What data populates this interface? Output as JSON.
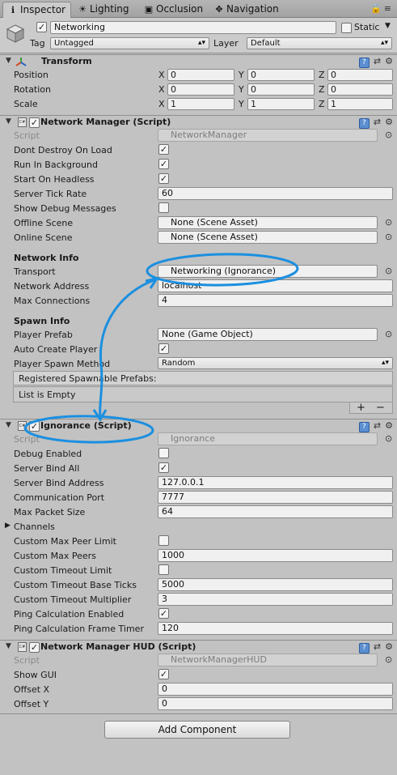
{
  "tabs": [
    {
      "label": "Inspector",
      "icon": "info-icon"
    },
    {
      "label": "Lighting",
      "icon": "bulb-icon"
    },
    {
      "label": "Occlusion",
      "icon": "occlusion-icon"
    },
    {
      "label": "Navigation",
      "icon": "navigation-icon"
    }
  ],
  "header": {
    "object_name": "Networking",
    "static_label": "Static",
    "tag_label": "Tag",
    "tag_value": "Untagged",
    "layer_label": "Layer",
    "layer_value": "Default"
  },
  "transform": {
    "title": "Transform",
    "rows": [
      {
        "label": "Position",
        "x": "0",
        "y": "0",
        "z": "0"
      },
      {
        "label": "Rotation",
        "x": "0",
        "y": "0",
        "z": "0"
      },
      {
        "label": "Scale",
        "x": "1",
        "y": "1",
        "z": "1"
      }
    ],
    "axis_x": "X",
    "axis_y": "Y",
    "axis_z": "Z"
  },
  "network_manager": {
    "title": "Network Manager (Script)",
    "script_label": "Script",
    "script_value": "NetworkManager",
    "dont_destroy_label": "Dont Destroy On Load",
    "run_bg_label": "Run In Background",
    "start_headless_label": "Start On Headless",
    "tick_rate_label": "Server Tick Rate",
    "tick_rate_value": "60",
    "show_debug_label": "Show Debug Messages",
    "offline_scene_label": "Offline Scene",
    "offline_scene_value": "None (Scene Asset)",
    "online_scene_label": "Online Scene",
    "online_scene_value": "None (Scene Asset)",
    "network_info_heading": "Network Info",
    "transport_label": "Transport",
    "transport_value": "Networking (Ignorance)",
    "address_label": "Network Address",
    "address_value": "localhost",
    "max_conn_label": "Max Connections",
    "max_conn_value": "4",
    "spawn_info_heading": "Spawn Info",
    "player_prefab_label": "Player Prefab",
    "player_prefab_value": "None (Game Object)",
    "auto_create_label": "Auto Create Player",
    "spawn_method_label": "Player Spawn Method",
    "spawn_method_value": "Random",
    "registered_label": "Registered Spawnable Prefabs:",
    "list_empty": "List is Empty",
    "plus": "+",
    "minus": "−"
  },
  "ignorance": {
    "title": "Ignorance (Script)",
    "script_label": "Script",
    "script_value": "Ignorance",
    "debug_label": "Debug Enabled",
    "bind_all_label": "Server Bind All",
    "bind_addr_label": "Server Bind Address",
    "bind_addr_value": "127.0.0.1",
    "port_label": "Communication Port",
    "port_value": "7777",
    "packet_label": "Max Packet Size",
    "packet_value": "64",
    "channels_label": "Channels",
    "peer_limit_label": "Custom Max Peer Limit",
    "max_peers_label": "Custom Max Peers",
    "max_peers_value": "1000",
    "timeout_limit_label": "Custom Timeout Limit",
    "timeout_ticks_label": "Custom Timeout Base Ticks",
    "timeout_ticks_value": "5000",
    "timeout_mult_label": "Custom Timeout Multiplier",
    "timeout_mult_value": "3",
    "ping_enabled_label": "Ping Calculation Enabled",
    "ping_timer_label": "Ping Calculation Frame Timer",
    "ping_timer_value": "120"
  },
  "hud": {
    "title": "Network Manager HUD (Script)",
    "script_label": "Script",
    "script_value": "NetworkManagerHUD",
    "show_gui_label": "Show GUI",
    "offset_x_label": "Offset X",
    "offset_x_value": "0",
    "offset_y_label": "Offset Y",
    "offset_y_value": "0"
  },
  "add_component_label": "Add Component",
  "colors": {
    "annotation": "#1b8fe0",
    "panel": "#c2c2c2",
    "header": "#cbcbcb"
  }
}
